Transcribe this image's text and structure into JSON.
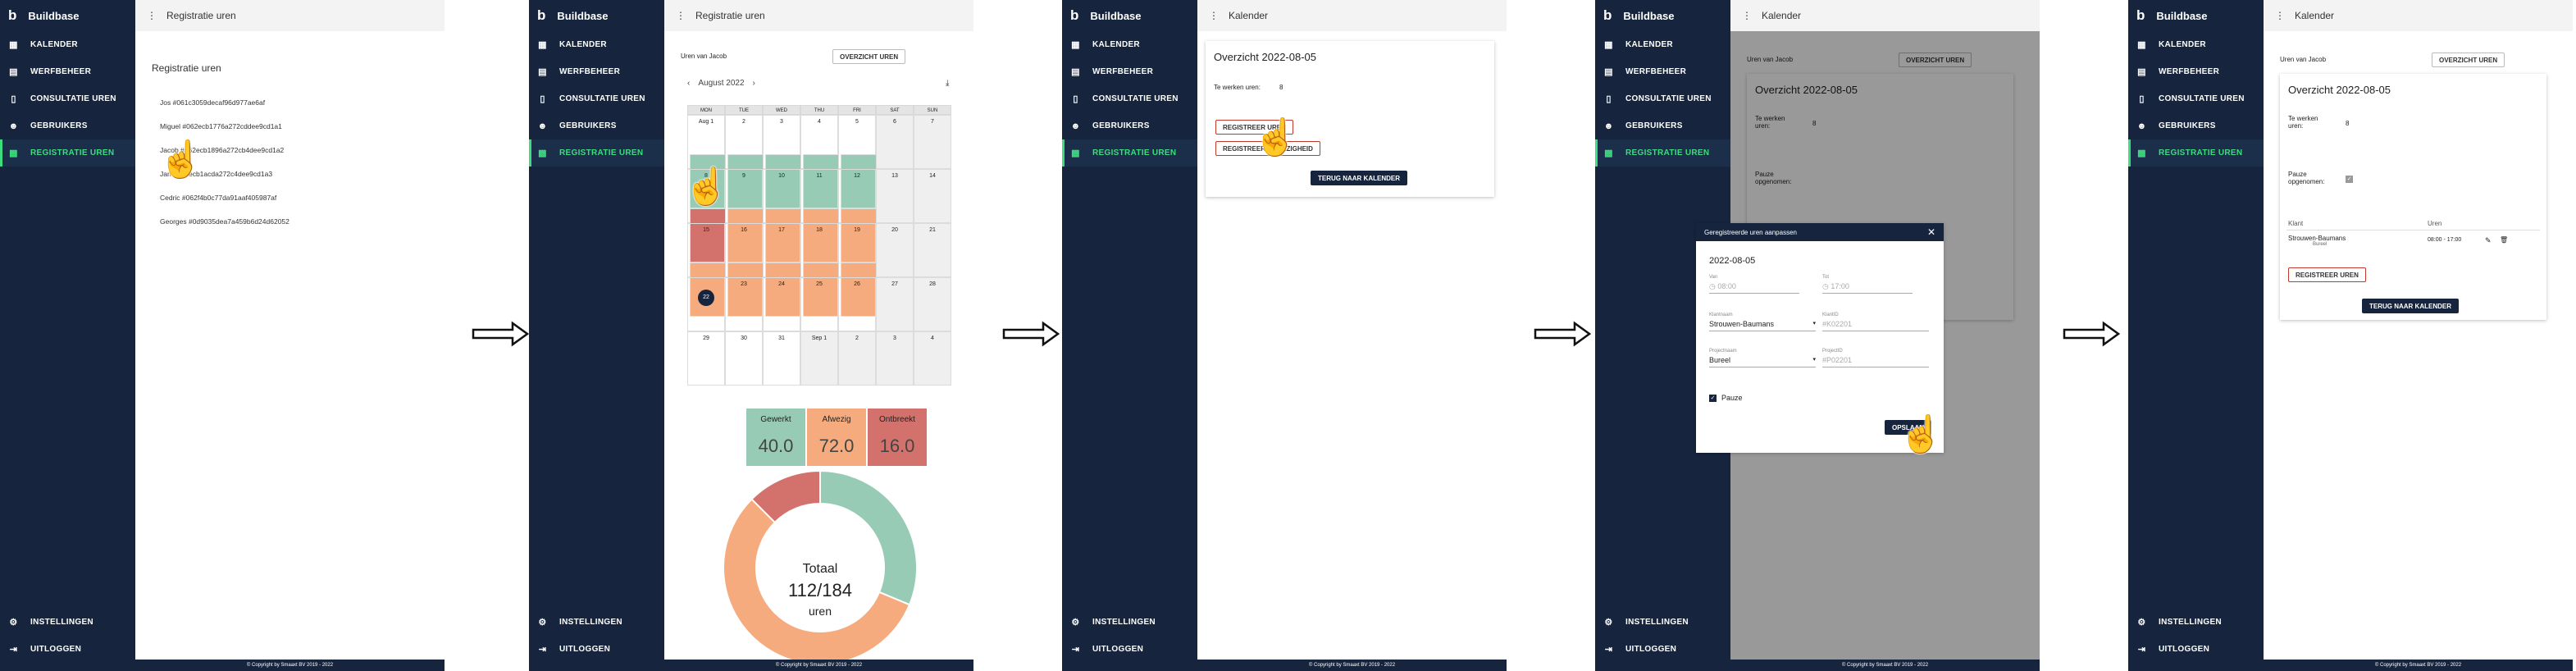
{
  "app": {
    "brand_logo": "b",
    "brand_name": "Buildbase",
    "nav": [
      {
        "label": "KALENDER",
        "icon": "calendar-icon"
      },
      {
        "label": "WERFBEHEER",
        "icon": "id-card-icon"
      },
      {
        "label": "CONSULTATIE UREN",
        "icon": "document-icon"
      },
      {
        "label": "GEBRUIKERS",
        "icon": "users-icon"
      },
      {
        "label": "REGISTRATIE UREN",
        "icon": "calendar-check-icon"
      }
    ],
    "nav_bottom": [
      {
        "label": "INSTELLINGEN",
        "icon": "gear-icon"
      },
      {
        "label": "UITLOGGEN",
        "icon": "logout-icon"
      }
    ],
    "footer": "© Copyright by Smaaxt BV 2019 - 2022",
    "menu_glyph": "⋮",
    "colors": {
      "sidebar": "#16253d",
      "active": "#3ddc7e",
      "gewerkt": "#97cbb5",
      "afwezig": "#f5ab7d",
      "ontbreekt": "#d3716c"
    }
  },
  "panel1": {
    "topbar": "Registratie uren",
    "heading": "Registratie uren",
    "users": [
      "Jos #061c3059decaf96d977ae6af",
      "Miguel #062ecb1776a272cddee9cd1a1",
      "Jacob #062ecb1896a272cb4dee9cd1a2",
      "Jan #062ecb1acda272c4dee9cd1a3",
      "Cedric #062f4b0c77da91aaf405987af",
      "Georges #0d9035dea7a459b6d24d62052"
    ]
  },
  "panel2": {
    "topbar": "Registratie uren",
    "uren_van": "Uren van Jacob",
    "overzicht_btn": "OVERZICHT UREN",
    "month": "August 2022",
    "weekdays": [
      "MON",
      "TUE",
      "WED",
      "THU",
      "FRI",
      "SAT",
      "SUN"
    ],
    "weeks": [
      [
        "Aug 1",
        "2",
        "3",
        "4",
        "5",
        "6",
        "7"
      ],
      [
        "8",
        "9",
        "10",
        "11",
        "12",
        "13",
        "14"
      ],
      [
        "15",
        "16",
        "17",
        "18",
        "19",
        "20",
        "21"
      ],
      [
        "22",
        "23",
        "24",
        "25",
        "26",
        "27",
        "28"
      ],
      [
        "29",
        "30",
        "31",
        "Sep 1",
        "2",
        "3",
        "4"
      ]
    ],
    "today": "22",
    "stats": [
      {
        "label": "Gewerkt",
        "value": "40.0"
      },
      {
        "label": "Afwezig",
        "value": "72.0"
      },
      {
        "label": "Ontbreekt",
        "value": "16.0"
      }
    ],
    "donut": {
      "title": "Totaal",
      "value": "112/184",
      "unit": "uren",
      "gewerkt": 40,
      "afwezig": 72,
      "ontbreekt": 16
    }
  },
  "panel3": {
    "topbar": "Kalender",
    "title": "Overzicht 2022-08-05",
    "te_werken_label": "Te werken uren:",
    "te_werken_value": "8",
    "btn_registreer": "REGISTREER UREN",
    "btn_afwezigheid": "REGISTREER AFWEZIGHEID",
    "btn_terug": "TERUG NAAR KALENDER"
  },
  "panel4": {
    "topbar": "Kalender",
    "uren_van": "Uren van Jacob",
    "overzicht_btn": "OVERZICHT UREN",
    "title": "Overzicht 2022-08-05",
    "te_werken_label": "Te werken uren:",
    "te_werken_value": "8",
    "pauze_label": "Pauze opgenomen:",
    "modal": {
      "title": "Geregistreerde uren aanpassen",
      "date": "2022-08-05",
      "van_label": "Van",
      "van_value": "08:00",
      "tot_label": "Tot",
      "tot_value": "17:00",
      "klant_label": "Klantnaam",
      "klant_value": "Strouwen-Baumans",
      "klantid_label": "KlantID",
      "klantid_value": "#K02201",
      "project_label": "Projectnaam",
      "project_value": "Bureel",
      "projectid_label": "ProjectID",
      "projectid_value": "#P02201",
      "pauze": "Pauze",
      "opslaan": "OPSLAAN"
    }
  },
  "panel5": {
    "topbar": "Kalender",
    "uren_van": "Uren van Jacob",
    "overzicht_btn": "OVERZICHT UREN",
    "title": "Overzicht 2022-08-05",
    "te_werken_label": "Te werken uren:",
    "te_werken_value": "8",
    "pauze_label": "Pauze opgenomen:",
    "col_klant": "Klant",
    "col_uren": "Uren",
    "row_klant": "Strouwen-Baumans",
    "row_project": "Bureel",
    "row_uren": "08:00 - 17:00",
    "btn_registreer": "REGISTREER UREN",
    "btn_terug": "TERUG NAAR KALENDER"
  }
}
